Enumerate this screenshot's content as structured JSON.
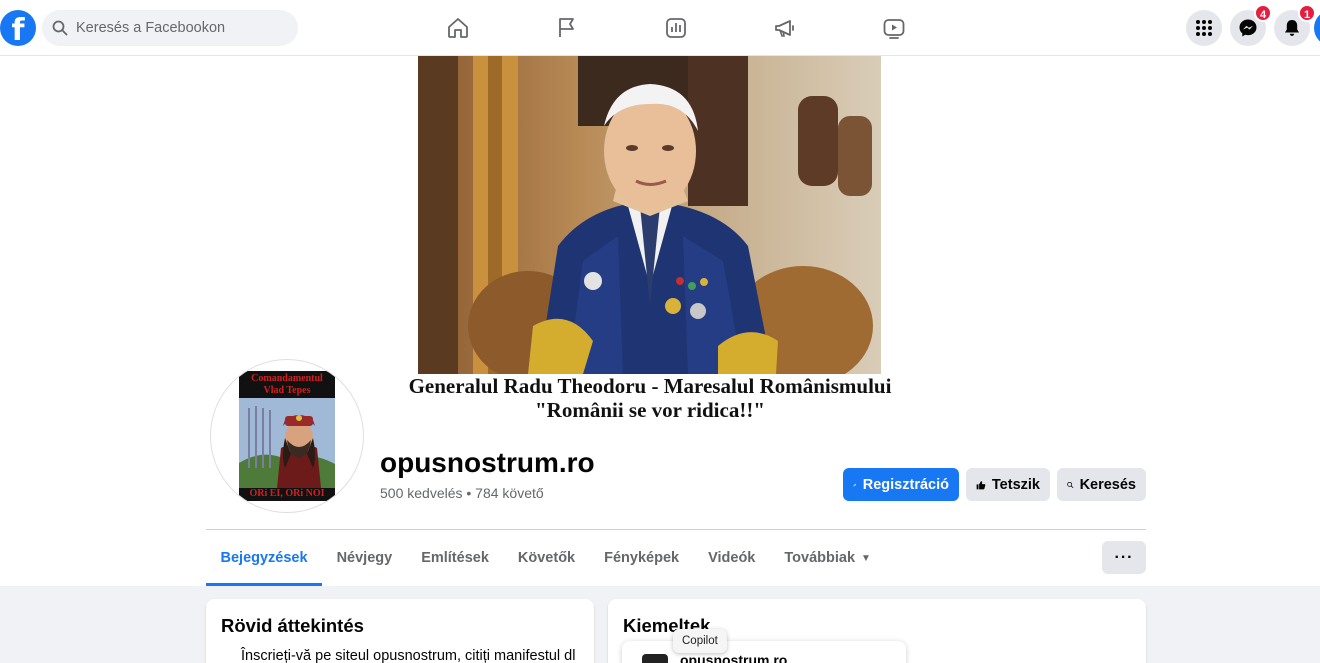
{
  "header": {
    "logo": "f",
    "search_placeholder": "Keresés a Facebookon",
    "nav_icons": [
      "home-icon",
      "flag-icon",
      "chart-icon",
      "megaphone-icon",
      "video-icon"
    ],
    "right_icons": [
      "menu-grid-icon",
      "messenger-icon",
      "bell-icon"
    ],
    "messenger_badge": "4",
    "notifications_badge": "1"
  },
  "cover": {
    "caption_line1": "Generalul Radu Theodoru - Maresalul Românismului",
    "caption_line2": "\"Românii se vor ridica!!\""
  },
  "avatar": {
    "top_text_1": "Comandamentul",
    "top_text_2": "Vlad Tepes",
    "bottom_text": "ORi EI, ORi NOI"
  },
  "page": {
    "name": "opusnostrum.ro",
    "stats": "500 kedvelés • 784 követő"
  },
  "actions": {
    "register": "Regisztráció",
    "like": "Tetszik",
    "search": "Keresés"
  },
  "tabs": [
    {
      "label": "Bejegyzések"
    },
    {
      "label": "Névjegy"
    },
    {
      "label": "Említések"
    },
    {
      "label": "Követők"
    },
    {
      "label": "Fényképek"
    },
    {
      "label": "Videók"
    },
    {
      "label": "Továbbiak"
    }
  ],
  "more_button": "···",
  "intro": {
    "title": "Rövid áttekintés",
    "text": "Înscrieți-vă pe siteul opusnostrum, citiți manifestul dl"
  },
  "highlights": {
    "title": "Kiemeltek",
    "tooltip": "Copilot",
    "item_name": "opusnostrum.ro"
  },
  "colors": {
    "brand": "#1877f2",
    "badge": "#e41e3f"
  }
}
